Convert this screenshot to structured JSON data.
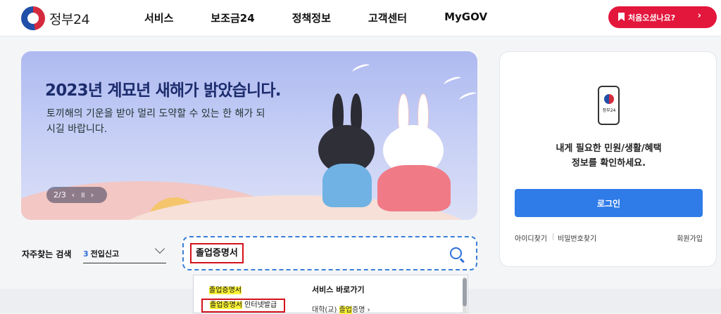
{
  "header": {
    "logo_text": "정부24",
    "nav": [
      "서비스",
      "보조금24",
      "정책정보",
      "고객센터",
      "MyGOV"
    ],
    "first_visit_label": "처음오셨나요?",
    "first_visit_chevron": "›"
  },
  "banner": {
    "title": "2023년 계묘년 새해가 밝았습니다.",
    "subtitle": "토끼해의 기운을 받아 멀리 도약할 수 있는 한 해가 되시길 바랍니다.",
    "pager": {
      "current": "2/3",
      "prev": "‹",
      "pause": "॥",
      "next": "›"
    }
  },
  "login_card": {
    "phone_text": "정부24",
    "message": "내게 필요한 민원/생활/혜택\n정보를 확인하세요.",
    "login_label": "로그인",
    "find_id": "아이디찾기",
    "find_pw": "비밀번호찾기",
    "signup": "회원가입"
  },
  "search": {
    "freq_label": "자주찾는 검색",
    "freq_rank": "3",
    "freq_term": "전입신고",
    "query": "졸업증명서"
  },
  "autocomplete": {
    "items": [
      {
        "highlight": "졸업증명서",
        "rest": ""
      },
      {
        "highlight": "졸업증명서",
        "rest": " 인터넷발급"
      }
    ],
    "shortcut_heading": "서비스 바로가기",
    "shortcut_pre": "대학(교) ",
    "shortcut_hl": "졸업",
    "shortcut_post": "증명",
    "shortcut_chevron": "›"
  },
  "colors": {
    "accent": "#2f7be8",
    "brand_red": "#e3163c",
    "highlight": "#fbf336"
  }
}
